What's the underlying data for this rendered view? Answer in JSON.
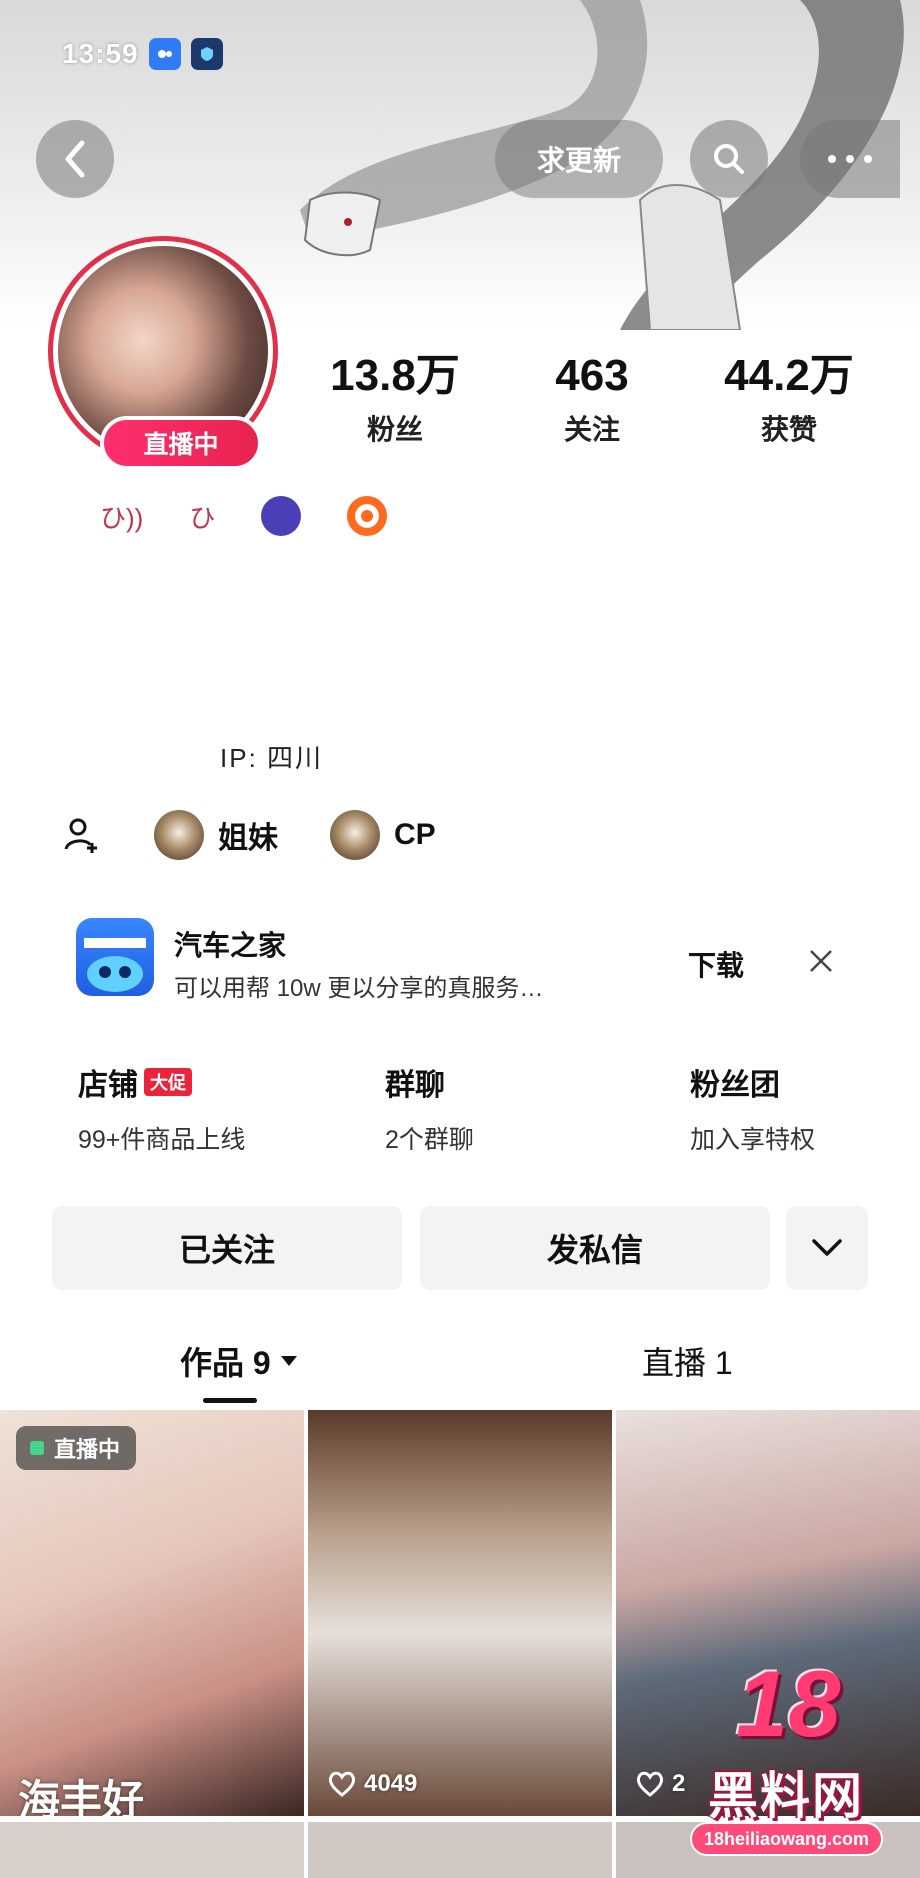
{
  "status_bar": {
    "time": "13:59"
  },
  "header": {
    "update_label": "求更新"
  },
  "profile": {
    "live_badge": "直播中",
    "stats": [
      {
        "value": "13.8万",
        "label": "粉丝"
      },
      {
        "value": "463",
        "label": "关注"
      },
      {
        "value": "44.2万",
        "label": "获赞"
      }
    ],
    "badges": [
      "ひ))",
      "ひ"
    ],
    "location": "IP: 四川"
  },
  "relations": [
    {
      "label": "姐妹"
    },
    {
      "label": "CP"
    }
  ],
  "promo": {
    "title": "汽车之家",
    "description": "可以用帮 10w 更以分享的真服务…",
    "download_label": "下载"
  },
  "shortcuts": [
    {
      "title": "店铺",
      "tag": "大促",
      "subtitle": "99+件商品上线"
    },
    {
      "title": "群聊",
      "subtitle": "2个群聊"
    },
    {
      "title": "粉丝团",
      "subtitle": "加入享特权"
    }
  ],
  "actions": {
    "follow_label": "已关注",
    "message_label": "发私信"
  },
  "tabs": [
    {
      "label": "作品 9"
    },
    {
      "label": "直播 1"
    }
  ],
  "grid": {
    "items": [
      {
        "live_tag": "直播中",
        "caption": "海丰好"
      },
      {
        "likes": "4049"
      },
      {
        "likes": "2"
      }
    ]
  },
  "watermark": {
    "number": "18",
    "name": "黑料网",
    "url": "18heiliaowang.com"
  },
  "colors": {
    "live_red": "#e8234f",
    "accent_blue": "#1f5fe0"
  }
}
